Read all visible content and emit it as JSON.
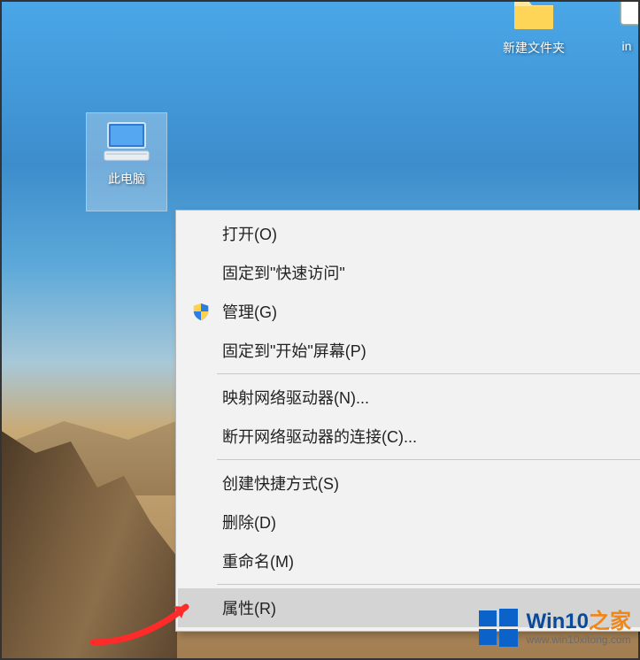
{
  "desktop_icons": {
    "folder": {
      "label": "新建文件夹"
    },
    "right_partial": {
      "label": "in"
    },
    "this_pc": {
      "label": "此电脑"
    }
  },
  "context_menu": {
    "open": "打开(O)",
    "pin_quick_access": "固定到\"快速访问\"",
    "manage": "管理(G)",
    "pin_start": "固定到\"开始\"屏幕(P)",
    "map_drive": "映射网络驱动器(N)...",
    "disconnect_drive": "断开网络驱动器的连接(C)...",
    "create_shortcut": "创建快捷方式(S)",
    "delete": "删除(D)",
    "rename": "重命名(M)",
    "properties": "属性(R)"
  },
  "watermark": {
    "title_main": "Win10",
    "title_accent": "之家",
    "url": "www.win10xitong.com"
  }
}
